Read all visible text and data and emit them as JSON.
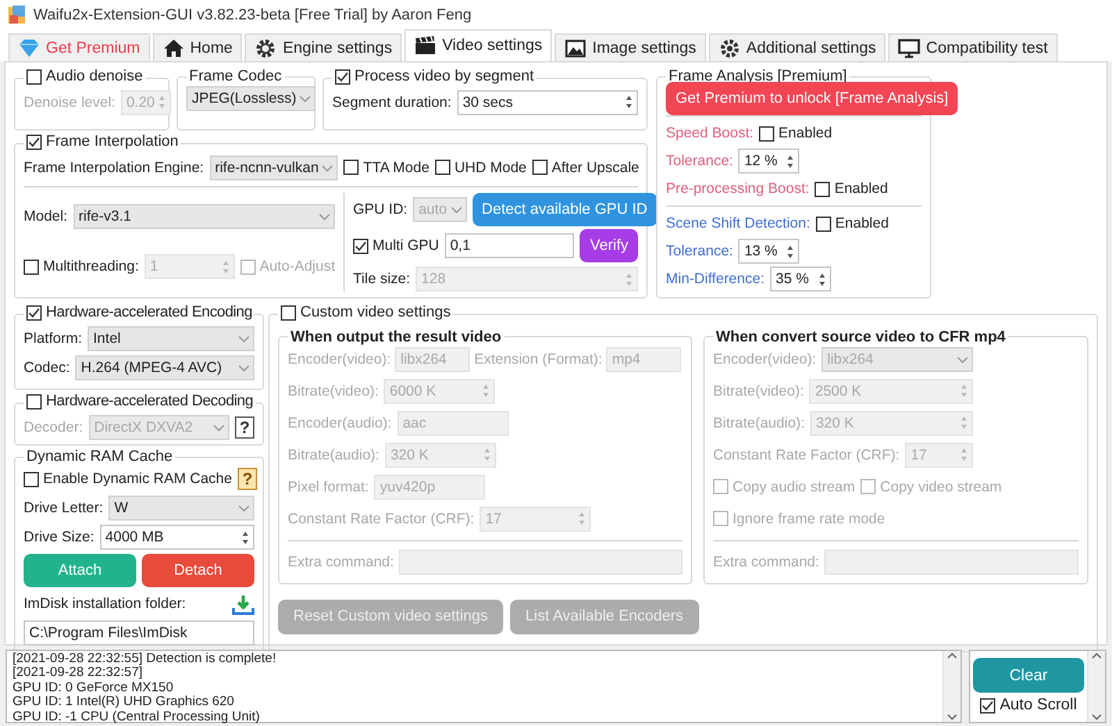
{
  "window": {
    "title": "Waifu2x-Extension-GUI v3.82.23-beta [Free Trial] by Aaron Feng"
  },
  "tabs": [
    {
      "label": "Get Premium",
      "kind": "premium",
      "selected": false
    },
    {
      "label": "Home",
      "kind": "page",
      "selected": false
    },
    {
      "label": "Engine settings",
      "kind": "page",
      "selected": false
    },
    {
      "label": "Video settings",
      "kind": "page",
      "selected": true
    },
    {
      "label": "Image settings",
      "kind": "page",
      "selected": false
    },
    {
      "label": "Additional settings",
      "kind": "page",
      "selected": false
    },
    {
      "label": "Compatibility test",
      "kind": "page",
      "selected": false
    }
  ],
  "top_groups": [
    {
      "header": {
        "kind": "checkbox",
        "label": "Audio denoise",
        "checked": false,
        "disabled": false
      },
      "rows": [
        [
          {
            "kind": "label",
            "text": "Denoise level:",
            "disabled": true
          },
          {
            "kind": "spin",
            "value": "0.20",
            "disabled": true
          }
        ]
      ]
    },
    {
      "header": {
        "kind": "label",
        "text": "Frame Codec",
        "disabled": false
      },
      "rows": [
        [
          {
            "kind": "combo",
            "value": "JPEG(Lossless)",
            "disabled": false
          }
        ]
      ]
    },
    {
      "header": {
        "kind": "checkbox",
        "label": "Process video by segment",
        "checked": true,
        "disabled": false
      },
      "rows": [
        [
          {
            "kind": "label",
            "text": "Segment duration:",
            "disabled": false
          },
          {
            "kind": "spin",
            "value": "30 secs",
            "disabled": false
          }
        ]
      ]
    }
  ],
  "frame_interpolation": {
    "header": {
      "kind": "checkbox",
      "label": "Frame Interpolation",
      "checked": true,
      "disabled": false
    },
    "rows": [
      [
        {
          "kind": "label",
          "text": "Frame Interpolation Engine:",
          "disabled": false
        },
        {
          "kind": "combo",
          "value": "rife-ncnn-vulkan",
          "disabled": false
        },
        {
          "kind": "checkbox",
          "label": "TTA Mode",
          "checked": false,
          "disabled": false
        },
        {
          "kind": "checkbox",
          "label": "UHD Mode",
          "checked": false,
          "disabled": false
        },
        {
          "kind": "checkbox",
          "label": "After Upscale",
          "checked": false,
          "disabled": false
        }
      ],
      {
        "rule": true
      },
      {
        "columns": [
          [
            [
              {
                "kind": "label",
                "text": "Model:",
                "disabled": false
              },
              {
                "kind": "combo",
                "value": "rife-v3.1",
                "disabled": false
              }
            ],
            [
              {
                "kind": "checkbox",
                "label": "Multithreading:",
                "checked": false,
                "disabled": false
              },
              {
                "kind": "spin",
                "value": "1",
                "disabled": true
              },
              {
                "kind": "checkbox",
                "label": "Auto-Adjust",
                "checked": false,
                "disabled": true
              }
            ]
          ],
          [
            [
              {
                "kind": "label",
                "text": "GPU ID:",
                "disabled": false
              },
              {
                "kind": "combo",
                "value": "auto",
                "disabled": true
              },
              {
                "kind": "button",
                "label": "Detect available GPU ID",
                "color": "#2f93e0",
                "disabled": false
              }
            ],
            [
              {
                "kind": "checkbox",
                "label": "Multi GPU",
                "checked": true,
                "disabled": false
              },
              {
                "kind": "field",
                "value": "0,1",
                "disabled": false
              },
              {
                "kind": "button",
                "label": "Verify",
                "color": "#a63de6",
                "disabled": false
              }
            ],
            [
              {
                "kind": "label",
                "text": "Tile size:",
                "disabled": false
              },
              {
                "kind": "spin",
                "value": "128",
                "disabled": true
              }
            ]
          ]
        ]
      }
    ]
  },
  "frame_analysis": {
    "header": {
      "kind": "label",
      "text": "Frame Analysis [Premium]",
      "disabled": false
    },
    "rows": [
      [
        {
          "kind": "button",
          "label": "Get Premium to unlock [Frame Analysis]",
          "color": "#f24655",
          "disabled": false
        }
      ],
      {
        "rule": true
      },
      [
        {
          "kind": "label",
          "text": "Speed Boost:",
          "color": "#e0607c",
          "disabled": false
        },
        {
          "kind": "checkbox",
          "label": "Enabled",
          "checked": false,
          "disabled": false
        }
      ],
      [
        {
          "kind": "label",
          "text": "Tolerance:",
          "color": "#e0607c",
          "disabled": false
        },
        {
          "kind": "spin",
          "value": "12 %",
          "disabled": false
        }
      ],
      [
        {
          "kind": "label",
          "text": "Pre-processing Boost:",
          "color": "#e0607c",
          "disabled": false
        },
        {
          "kind": "checkbox",
          "label": "Enabled",
          "checked": false,
          "disabled": false
        }
      ],
      {
        "rule": true
      },
      [
        {
          "kind": "label",
          "text": "Scene Shift Detection:",
          "color": "#3f6fd0",
          "disabled": false
        },
        {
          "kind": "checkbox",
          "label": "Enabled",
          "checked": false,
          "disabled": false
        }
      ],
      [
        {
          "kind": "label",
          "text": "Tolerance:",
          "color": "#3f6fd0",
          "disabled": false
        },
        {
          "kind": "spin",
          "value": "13 %",
          "disabled": false
        }
      ],
      [
        {
          "kind": "label",
          "text": "Min-Difference:",
          "color": "#3f6fd0",
          "disabled": false
        },
        {
          "kind": "spin",
          "value": "35 %",
          "disabled": false
        }
      ]
    ]
  },
  "encoding": {
    "header": {
      "kind": "checkbox",
      "label": "Hardware-accelerated Encoding",
      "checked": true,
      "disabled": false
    },
    "rows": [
      [
        {
          "kind": "label",
          "text": "Platform:",
          "disabled": false
        },
        {
          "kind": "combo",
          "value": "Intel",
          "disabled": false
        }
      ],
      [
        {
          "kind": "label",
          "text": "Codec:",
          "disabled": false
        },
        {
          "kind": "combo",
          "value": "H.264 (MPEG-4 AVC)",
          "disabled": false
        }
      ]
    ]
  },
  "decoding": {
    "header": {
      "kind": "checkbox",
      "label": "Hardware-accelerated Decoding",
      "checked": false,
      "disabled": false
    },
    "rows": [
      [
        {
          "kind": "label",
          "text": "Decoder:",
          "disabled": true
        },
        {
          "kind": "combo",
          "value": "DirectX DXVA2",
          "disabled": true
        },
        {
          "kind": "help",
          "text": "?",
          "disabled": true
        }
      ]
    ]
  },
  "ram_cache": {
    "header": {
      "kind": "label",
      "text": "Dynamic RAM Cache",
      "disabled": false
    },
    "rows": [
      [
        {
          "kind": "checkbox",
          "label": "Enable Dynamic RAM Cache",
          "checked": false,
          "disabled": false
        },
        {
          "kind": "help",
          "text": "?",
          "disabled": false
        }
      ],
      [
        {
          "kind": "label",
          "text": "Drive Letter:",
          "disabled": false
        },
        {
          "kind": "combo",
          "value": "W",
          "disabled": false
        }
      ],
      [
        {
          "kind": "label",
          "text": "Drive Size:",
          "disabled": false
        },
        {
          "kind": "spin",
          "value": "4000 MB",
          "disabled": false
        }
      ],
      [
        {
          "kind": "button",
          "label": "Attach",
          "color": "#22b38c",
          "disabled": false
        },
        {
          "kind": "button",
          "label": "Detach",
          "color": "#e84a3c",
          "disabled": false
        }
      ],
      [
        {
          "kind": "label",
          "text": "ImDisk installation folder:",
          "disabled": false
        },
        {
          "kind": "download",
          "disabled": false
        }
      ],
      [
        {
          "kind": "field",
          "value": "C:\\Program Files\\ImDisk",
          "disabled": false
        }
      ]
    ]
  },
  "custom_video": {
    "header": {
      "kind": "checkbox",
      "label": "Custom video settings",
      "checked": false,
      "disabled": false
    },
    "output": {
      "header": {
        "kind": "label",
        "text": "When output the result video",
        "disabled": false
      },
      "rows": [
        [
          {
            "kind": "label",
            "text": "Encoder(video):",
            "disabled": true
          },
          {
            "kind": "field",
            "value": "libx264",
            "disabled": true
          },
          {
            "kind": "label",
            "text": "Extension (Format):",
            "disabled": true
          },
          {
            "kind": "field",
            "value": "mp4",
            "disabled": true
          }
        ],
        [
          {
            "kind": "label",
            "text": "Bitrate(video):",
            "disabled": true
          },
          {
            "kind": "spin",
            "value": "6000 K",
            "disabled": true
          }
        ],
        [
          {
            "kind": "label",
            "text": "Encoder(audio):",
            "disabled": true
          },
          {
            "kind": "field",
            "value": "aac",
            "disabled": true
          }
        ],
        [
          {
            "kind": "label",
            "text": "Bitrate(audio):",
            "disabled": true
          },
          {
            "kind": "spin",
            "value": "320 K",
            "disabled": true
          }
        ],
        [
          {
            "kind": "label",
            "text": "Pixel format:",
            "disabled": true
          },
          {
            "kind": "field",
            "value": "yuv420p",
            "disabled": true
          }
        ],
        [
          {
            "kind": "label",
            "text": "Constant Rate Factor (CRF):",
            "disabled": true
          },
          {
            "kind": "spin",
            "value": "17",
            "disabled": true
          }
        ],
        {
          "rule": true
        },
        [
          {
            "kind": "label",
            "text": "Extra command:",
            "disabled": true
          },
          {
            "kind": "field",
            "disabled": true
          }
        ]
      ]
    },
    "convert": {
      "header": {
        "kind": "label",
        "text": "When convert source video to CFR mp4",
        "disabled": false
      },
      "rows": [
        [
          {
            "kind": "label",
            "text": "Encoder(video):",
            "disabled": true
          },
          {
            "kind": "combo",
            "value": "libx264",
            "disabled": true
          }
        ],
        [
          {
            "kind": "label",
            "text": "Bitrate(video):",
            "disabled": true
          },
          {
            "kind": "spin",
            "value": "2500 K",
            "disabled": true
          }
        ],
        [
          {
            "kind": "label",
            "text": "Bitrate(audio):",
            "disabled": true
          },
          {
            "kind": "spin",
            "value": "320 K",
            "disabled": true
          }
        ],
        [
          {
            "kind": "label",
            "text": "Constant Rate Factor (CRF):",
            "disabled": true
          },
          {
            "kind": "spin",
            "value": "17",
            "disabled": true
          }
        ],
        [
          {
            "kind": "checkbox",
            "label": "Copy audio stream",
            "checked": false,
            "disabled": true
          },
          {
            "kind": "checkbox",
            "label": "Copy video stream",
            "checked": false,
            "disabled": true
          }
        ],
        [
          {
            "kind": "checkbox",
            "label": "Ignore frame rate mode",
            "checked": false,
            "disabled": true
          }
        ],
        {
          "rule": true
        },
        [
          {
            "kind": "label",
            "text": "Extra command:",
            "disabled": true
          },
          {
            "kind": "field",
            "disabled": true
          }
        ]
      ]
    },
    "buttons": [
      {
        "kind": "button",
        "label": "Reset Custom video settings",
        "disabled": true
      },
      {
        "kind": "button",
        "label": "List Available Encoders",
        "disabled": true
      }
    ]
  },
  "log": {
    "lines": [
      "[2021-09-28 22:32:55] Detection is complete!",
      "[2021-09-28 22:32:57]",
      "GPU ID: 0 GeForce MX150",
      "GPU ID: 1 Intel(R) UHD Graphics 620",
      "GPU ID: -1 CPU (Central Processing Unit)"
    ]
  },
  "clear_button": {
    "label": "Clear"
  },
  "auto_scroll": {
    "label": "Auto Scroll",
    "checked": true
  }
}
